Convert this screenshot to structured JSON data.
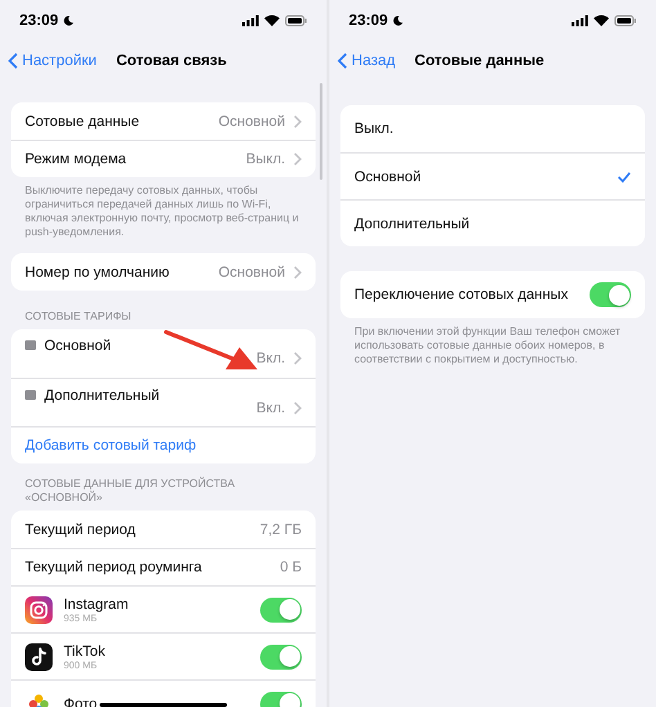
{
  "left": {
    "status": {
      "time": "23:09"
    },
    "nav": {
      "back": "Настройки",
      "title": "Сотовая связь"
    },
    "sections": [
      {
        "rows": [
          {
            "kind": "value",
            "label": "Сотовые данные",
            "value": "Основной"
          },
          {
            "kind": "value",
            "label": "Режим модема",
            "value": "Выкл."
          }
        ],
        "footer": "Выключите передачу сотовых данных, чтобы ограничиться передачей данных лишь по Wi-Fi, включая электронную почту, просмотр веб-страниц и push-уведомления."
      },
      {
        "rows": [
          {
            "kind": "value",
            "label": "Номер по умолчанию",
            "value": "Основной"
          }
        ]
      },
      {
        "header": "СОТОВЫЕ ТАРИФЫ",
        "rows": [
          {
            "kind": "sim",
            "label": "Основной",
            "value": "Вкл."
          },
          {
            "kind": "sim",
            "label": "Дополнительный",
            "value": "Вкл."
          },
          {
            "kind": "link",
            "label": "Добавить сотовый тариф"
          }
        ]
      },
      {
        "header": "СОТОВЫЕ ДАННЫЕ ДЛЯ УСТРОЙСТВА «ОСНОВНОЙ»",
        "rows": [
          {
            "kind": "stat",
            "label": "Текущий период",
            "value": "7,2 ГБ"
          },
          {
            "kind": "stat",
            "label": "Текущий период роуминга",
            "value": "0 Б"
          },
          {
            "kind": "app",
            "label": "Instagram",
            "detail": "935 МБ",
            "on": true
          },
          {
            "kind": "app",
            "label": "TikTok",
            "detail": "900 МБ",
            "on": true
          },
          {
            "kind": "app",
            "label": "Фото",
            "on": true
          }
        ]
      }
    ]
  },
  "right": {
    "status": {
      "time": "23:09"
    },
    "nav": {
      "back": "Назад",
      "title": "Сотовые данные"
    },
    "options": [
      {
        "label": "Выкл.",
        "selected": false
      },
      {
        "label": "Основной",
        "selected": true
      },
      {
        "label": "Дополнительный",
        "selected": false
      }
    ],
    "switch_row": {
      "label": "Переключение сотовых данных",
      "on": true
    },
    "footer": "При включении этой функции Ваш телефон сможет использовать сотовые данные обоих номеров, в соответствии с покрытием и доступностью."
  }
}
